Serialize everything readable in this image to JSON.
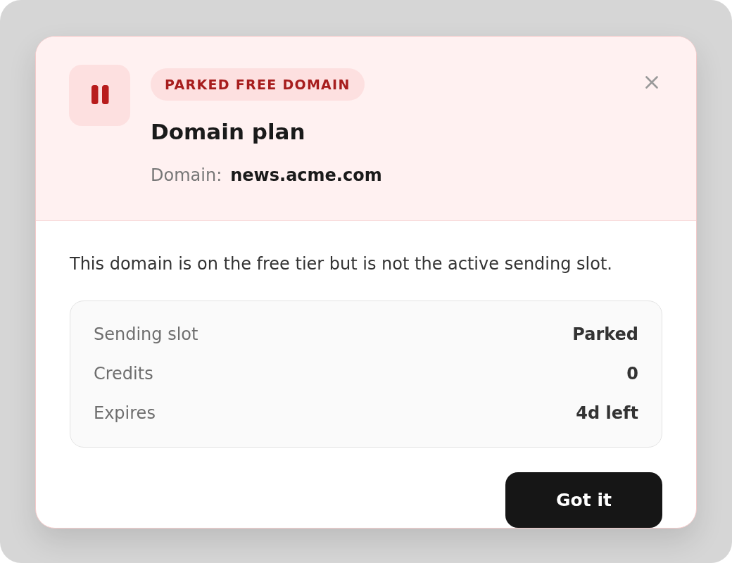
{
  "header": {
    "badge": "PARKED FREE DOMAIN",
    "title": "Domain plan",
    "domain": {
      "label": "Domain:",
      "value": "news.acme.com"
    }
  },
  "description": "This domain is on the free tier but is not the active sending slot.",
  "details": [
    {
      "label": "Sending slot",
      "value": "Parked"
    },
    {
      "label": "Credits",
      "value": "0"
    },
    {
      "label": "Expires",
      "value": "4d left"
    }
  ],
  "buttons": [
    "Got it"
  ]
}
